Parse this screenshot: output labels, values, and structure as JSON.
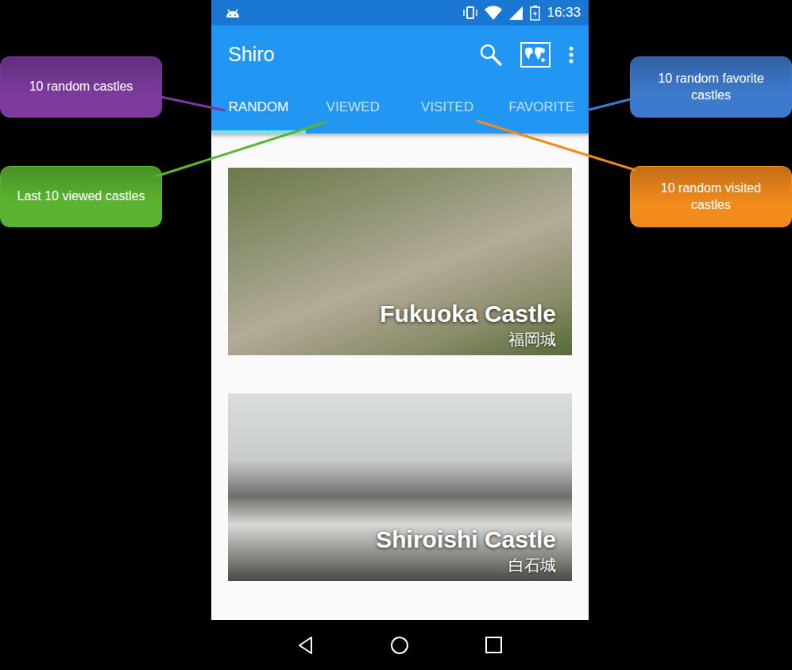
{
  "status_bar": {
    "time": "16:33"
  },
  "app_bar": {
    "title": "Shiro"
  },
  "tabs": [
    {
      "label": "RANDOM",
      "selected": true
    },
    {
      "label": "VIEWED",
      "selected": false
    },
    {
      "label": "VISITED",
      "selected": false
    },
    {
      "label": "FAVORITE",
      "selected": false
    }
  ],
  "cards": [
    {
      "title": "Fukuoka Castle",
      "subtitle": "福岡城"
    },
    {
      "title": "Shiroishi Castle",
      "subtitle": "白石城"
    }
  ],
  "annotations": [
    {
      "text": "10 random castles",
      "color": "#7b3a9c"
    },
    {
      "text": "Last 10 viewed castles",
      "color": "#5bb431"
    },
    {
      "text": "10 random favorite castles",
      "color": "#3d79cc"
    },
    {
      "text": "10 random visited castles",
      "color": "#f28a1c"
    }
  ]
}
